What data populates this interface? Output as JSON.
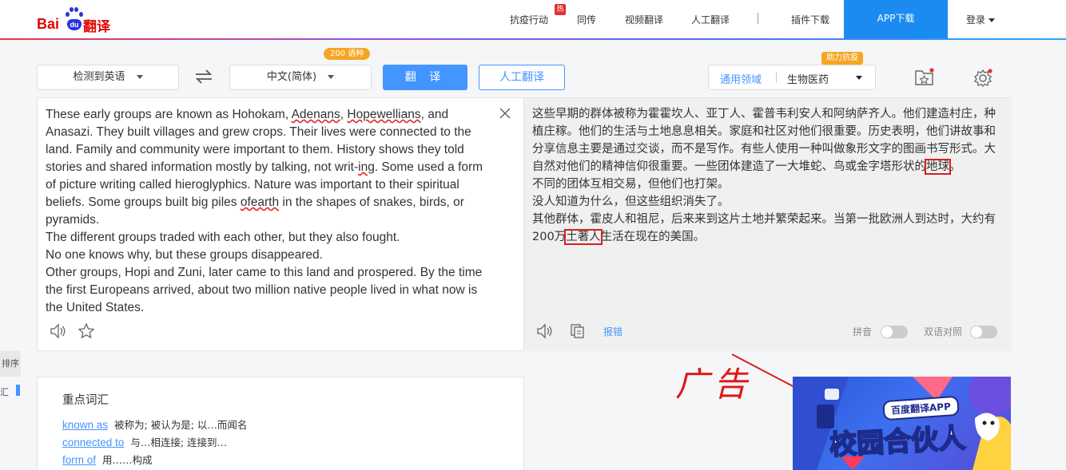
{
  "nav": {
    "brand": {
      "bai": "Bai",
      "du": "du",
      "fanyi": "翻译"
    },
    "items": [
      "抗疫行动",
      "同传",
      "视频翻译",
      "人工翻译",
      "插件下载"
    ],
    "hot_badge": "热",
    "app_download": "APP下载",
    "login": "登录"
  },
  "toolbar": {
    "source_lang": "检测到英语",
    "target_lang": "中文(简体)",
    "lang_count_badge": "200 语种",
    "translate_button": "翻 译",
    "human_translate_button": "人工翻译",
    "domain_label": "通用领域",
    "domain_value": "生物医药",
    "help_badge": "助力抗疫"
  },
  "source": {
    "lines": [
      [
        "These early groups are known as Hohokam, ",
        "Adenans",
        ", ",
        "Hopewellians",
        ", and Anasazi. They built villages and grew crops. Their lives were connected to the land. Family and community were important to them. History shows they told stories and shared information mostly by talking, not writ-",
        "ing",
        ". Some used a form of picture writing called hieroglyphics. Nature was important to their spiritual beliefs. Some groups built big piles ",
        "ofearth",
        " in the shapes of snakes, birds, or pyramids."
      ],
      "The different groups traded with each other, but they also fought.",
      "No one knows why, but these groups disappeared.",
      "Other groups, Hopi and Zuni, later came to this land and prospered. By the time the first Europeans arrived, about two million native people lived in what now is the United States."
    ]
  },
  "target": {
    "p1_before": "这些早期的群体被称为霍霍坎人、亚丁人、霍普韦利安人和阿纳萨齐人。他们建造村庄，种植庄稼。他们的生活与土地息息相关。家庭和社区对他们很重要。历史表明，他们讲故事和分享信息主要是通过交谈，而不是写作。有些人使用一种叫做象形文字的图画书写形式。大自然对他们的精神信仰很重要。一些团体建造了一大堆蛇、鸟或金字塔形状的",
    "p1_box": "地球",
    "p1_after": "。",
    "p2": "不同的团体互相交易，但他们也打架。",
    "p3": "没人知道为什么，但这些组织消失了。",
    "p4_before": "其他群体，霍皮人和祖尼，后来来到这片土地并繁荣起来。当第一批欧洲人到达时，大约有200万",
    "p4_box": "土著人",
    "p4_after": "生活在现在的美国。",
    "report": "报错",
    "pinyin_label": "拼音",
    "bilingual_label": "双语对照"
  },
  "sidebar": {
    "tab_text": "排序",
    "mark_text": "汇"
  },
  "vocab": {
    "title": "重点词汇",
    "items": [
      {
        "term": "known as",
        "meaning": "被称为; 被认为是; 以…而闻名"
      },
      {
        "term": "connected to",
        "meaning": "与…相连接; 连接到…"
      },
      {
        "term": "form of",
        "meaning": "用……构成"
      }
    ]
  },
  "annotation": "广告",
  "ad": {
    "banner_small": "百度翻译APP",
    "headline": "校园合伙人"
  },
  "colors": {
    "brand_red": "#e10602",
    "accent_blue": "#4395ff",
    "app_blue": "#1b8bf2",
    "badge_orange": "#f5a623",
    "highlight_red": "#d81e1e"
  }
}
